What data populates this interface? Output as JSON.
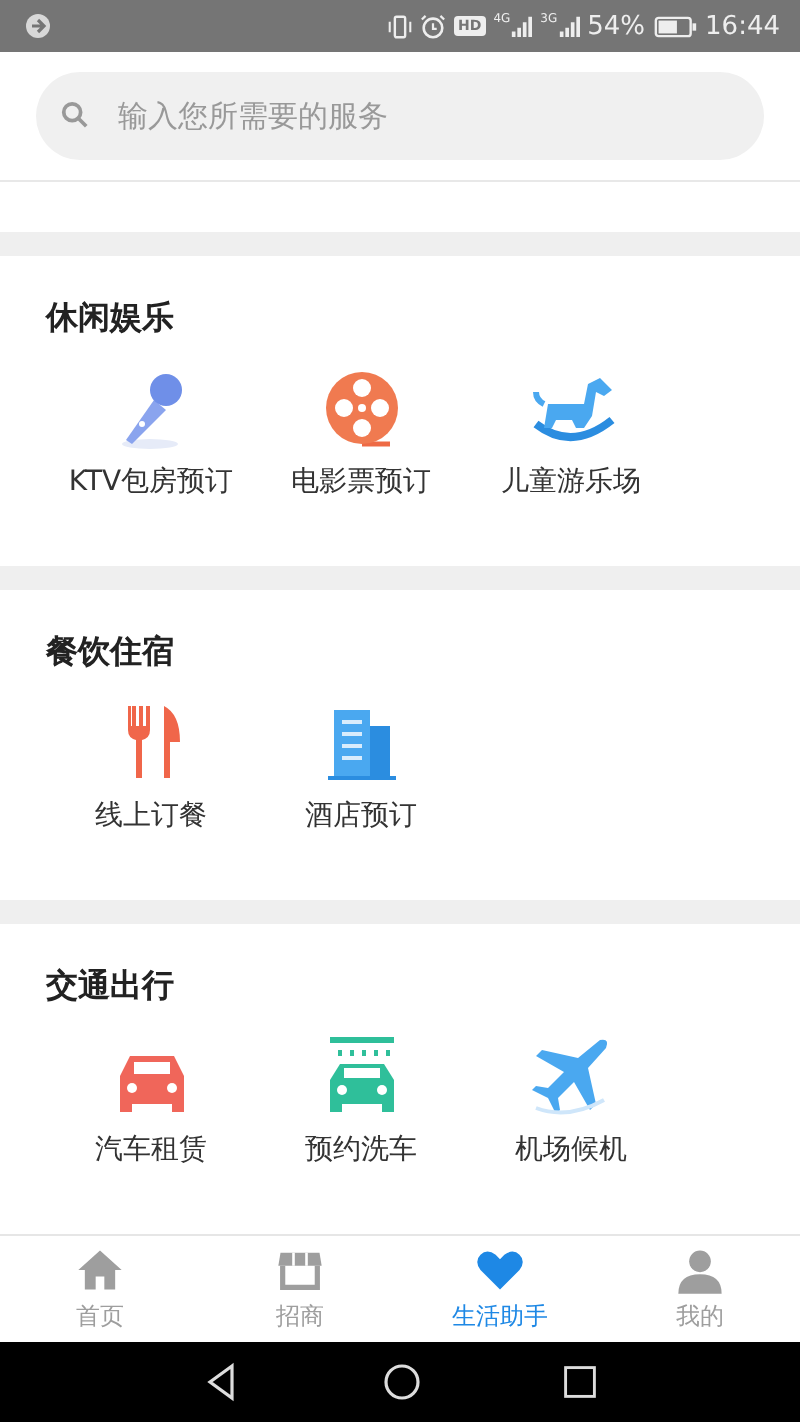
{
  "status_bar": {
    "hd": "HD",
    "network_1": "4G",
    "network_2": "3G",
    "battery": "54%",
    "time": "16:44"
  },
  "search": {
    "placeholder": "输入您所需要的服务"
  },
  "sections": [
    {
      "title": "休闲娱乐",
      "items": [
        {
          "label": "KTV包房预订"
        },
        {
          "label": "电影票预订"
        },
        {
          "label": "儿童游乐场"
        }
      ]
    },
    {
      "title": "餐饮住宿",
      "items": [
        {
          "label": "线上订餐"
        },
        {
          "label": "酒店预订"
        }
      ]
    },
    {
      "title": "交通出行",
      "items": [
        {
          "label": "汽车租赁"
        },
        {
          "label": "预约洗车"
        },
        {
          "label": "机场候机"
        }
      ]
    }
  ],
  "tab_bar": [
    {
      "label": "首页",
      "selected": false
    },
    {
      "label": "招商",
      "selected": false
    },
    {
      "label": "生活助手",
      "selected": true
    },
    {
      "label": "我的",
      "selected": false
    }
  ]
}
